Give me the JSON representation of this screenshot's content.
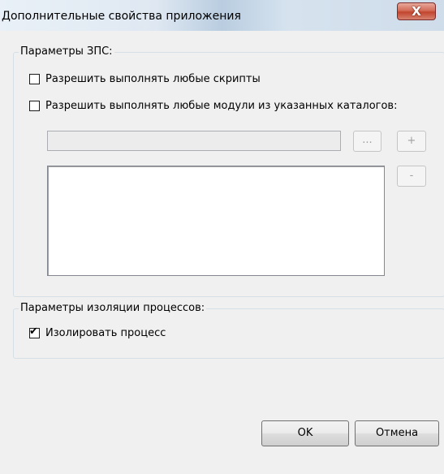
{
  "window": {
    "title": "Дополнительные свойства приложения",
    "close_label": "X"
  },
  "zps_group": {
    "caption": "Параметры ЗПС:",
    "allow_scripts": {
      "label": "Разрешить выполнять любые скрипты",
      "checked": false
    },
    "allow_modules": {
      "label": "Разрешить выполнять любые модули из указанных каталогов:",
      "checked": false
    },
    "path_value": "",
    "browse_label": "...",
    "add_label": "+",
    "remove_label": "-",
    "directories": []
  },
  "isolation_group": {
    "caption": "Параметры изоляции процессов:",
    "isolate_process": {
      "label": "Изолировать процесс",
      "checked": true,
      "mark": "✔"
    }
  },
  "buttons": {
    "ok": "OK",
    "cancel": "Отмена"
  }
}
